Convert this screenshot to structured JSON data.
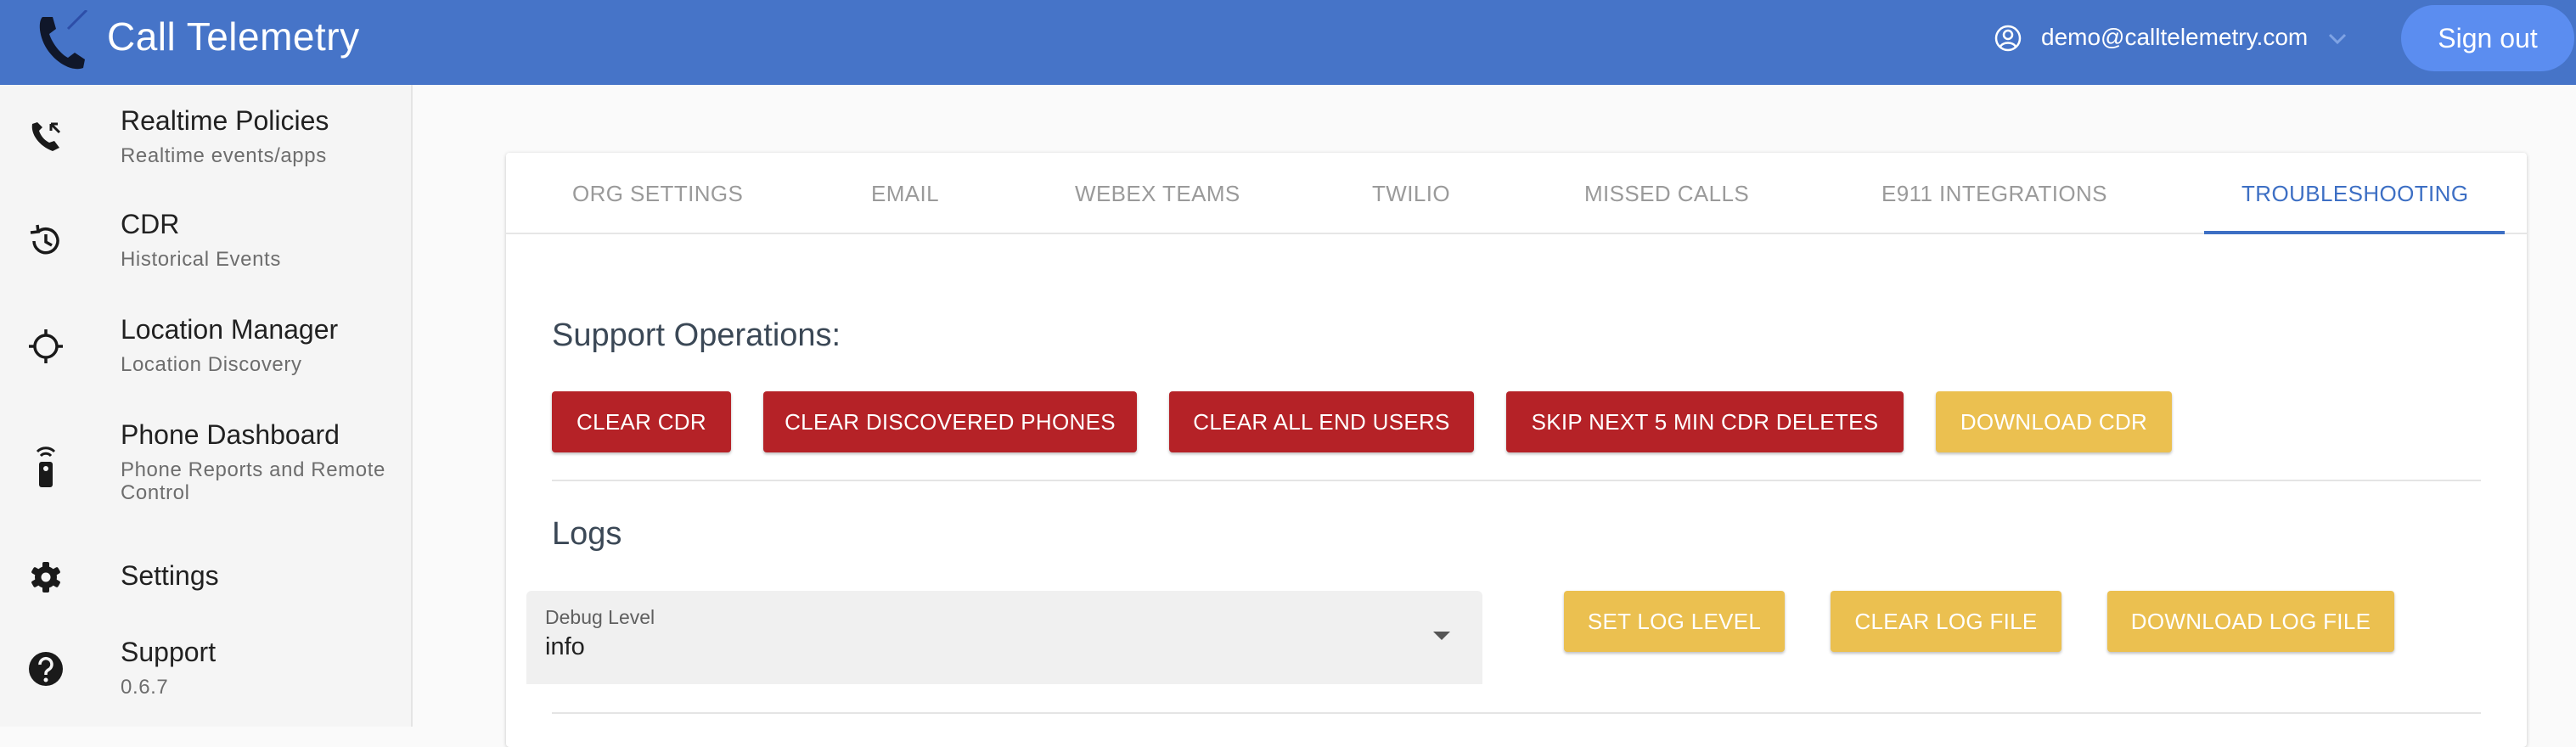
{
  "header": {
    "title": "Call Telemetry",
    "user_email": "demo@calltelemetry.com",
    "sign_out_label": "Sign out",
    "bg_color": "#4674c8"
  },
  "sidebar": {
    "items": [
      {
        "title": "Realtime Policies",
        "subtitle": "Realtime events/apps",
        "icon": "phone-callback-icon"
      },
      {
        "title": "CDR",
        "subtitle": "Historical Events",
        "icon": "history-icon"
      },
      {
        "title": "Location Manager",
        "subtitle": "Location Discovery",
        "icon": "location-crosshair-icon"
      },
      {
        "title": "Phone Dashboard",
        "subtitle": "Phone Reports and Remote Control",
        "icon": "remote-phone-icon"
      },
      {
        "title": "Settings",
        "subtitle": "",
        "icon": "gear-icon"
      },
      {
        "title": "Support",
        "subtitle": "0.6.7",
        "icon": "help-icon"
      }
    ]
  },
  "tabs": [
    {
      "label": "ORG SETTINGS",
      "active": false
    },
    {
      "label": "EMAIL",
      "active": false
    },
    {
      "label": "WEBEX TEAMS",
      "active": false
    },
    {
      "label": "TWILIO",
      "active": false
    },
    {
      "label": "MISSED CALLS",
      "active": false
    },
    {
      "label": "E911 INTEGRATIONS",
      "active": false
    },
    {
      "label": "TROUBLESHOOTING",
      "active": true
    }
  ],
  "support": {
    "title": "Support Operations:",
    "buttons": {
      "clear_cdr": "CLEAR CDR",
      "clear_discovered_phones": "CLEAR DISCOVERED PHONES",
      "clear_all_end_users": "CLEAR ALL END USERS",
      "skip_cdr_deletes": "SKIP NEXT 5 MIN CDR DELETES",
      "download_cdr": "DOWNLOAD CDR"
    }
  },
  "logs": {
    "title": "Logs",
    "debug_level_label": "Debug Level",
    "debug_level_value": "info",
    "buttons": {
      "set_log_level": "SET LOG LEVEL",
      "clear_log_file": "CLEAR LOG FILE",
      "download_log_file": "DOWNLOAD LOG FILE"
    }
  },
  "colors": {
    "danger": "#b52227",
    "warning": "#ebc050",
    "accent": "#3d6fc4"
  }
}
